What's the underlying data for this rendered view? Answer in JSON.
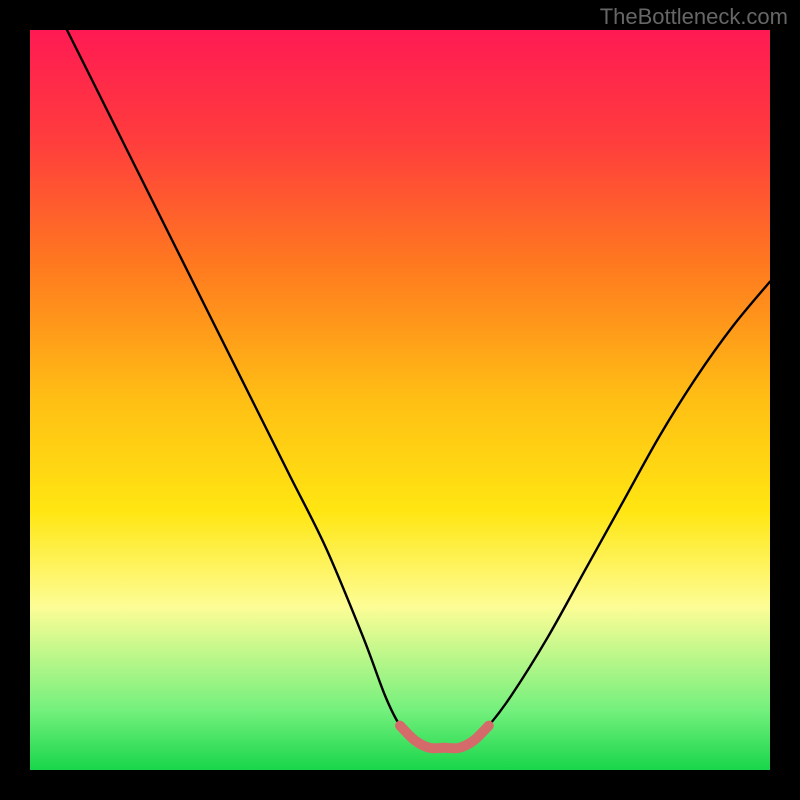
{
  "watermark": "TheBottleneck.com",
  "chart_data": {
    "type": "line",
    "title": "",
    "xlabel": "",
    "ylabel": "",
    "xlim": [
      0,
      100
    ],
    "ylim": [
      0,
      100
    ],
    "series": [
      {
        "name": "bottleneck-curve",
        "x": [
          5,
          10,
          15,
          20,
          25,
          30,
          35,
          40,
          45,
          48,
          50,
          52,
          54,
          56,
          58,
          60,
          62,
          65,
          70,
          75,
          80,
          85,
          90,
          95,
          100
        ],
        "values": [
          100,
          90,
          80,
          70,
          60,
          50,
          40,
          30,
          18,
          10,
          6,
          4,
          3,
          3,
          3,
          4,
          6,
          10,
          18,
          27,
          36,
          45,
          53,
          60,
          66
        ]
      },
      {
        "name": "highlight-band",
        "x": [
          50,
          52,
          54,
          56,
          58,
          60,
          62
        ],
        "values": [
          6,
          4,
          3,
          3,
          3,
          4,
          6
        ]
      }
    ],
    "colors": {
      "curve": "#000000",
      "highlight": "#d46a6a",
      "background_top": "#ff1a53",
      "background_bottom": "#18d64a"
    }
  }
}
